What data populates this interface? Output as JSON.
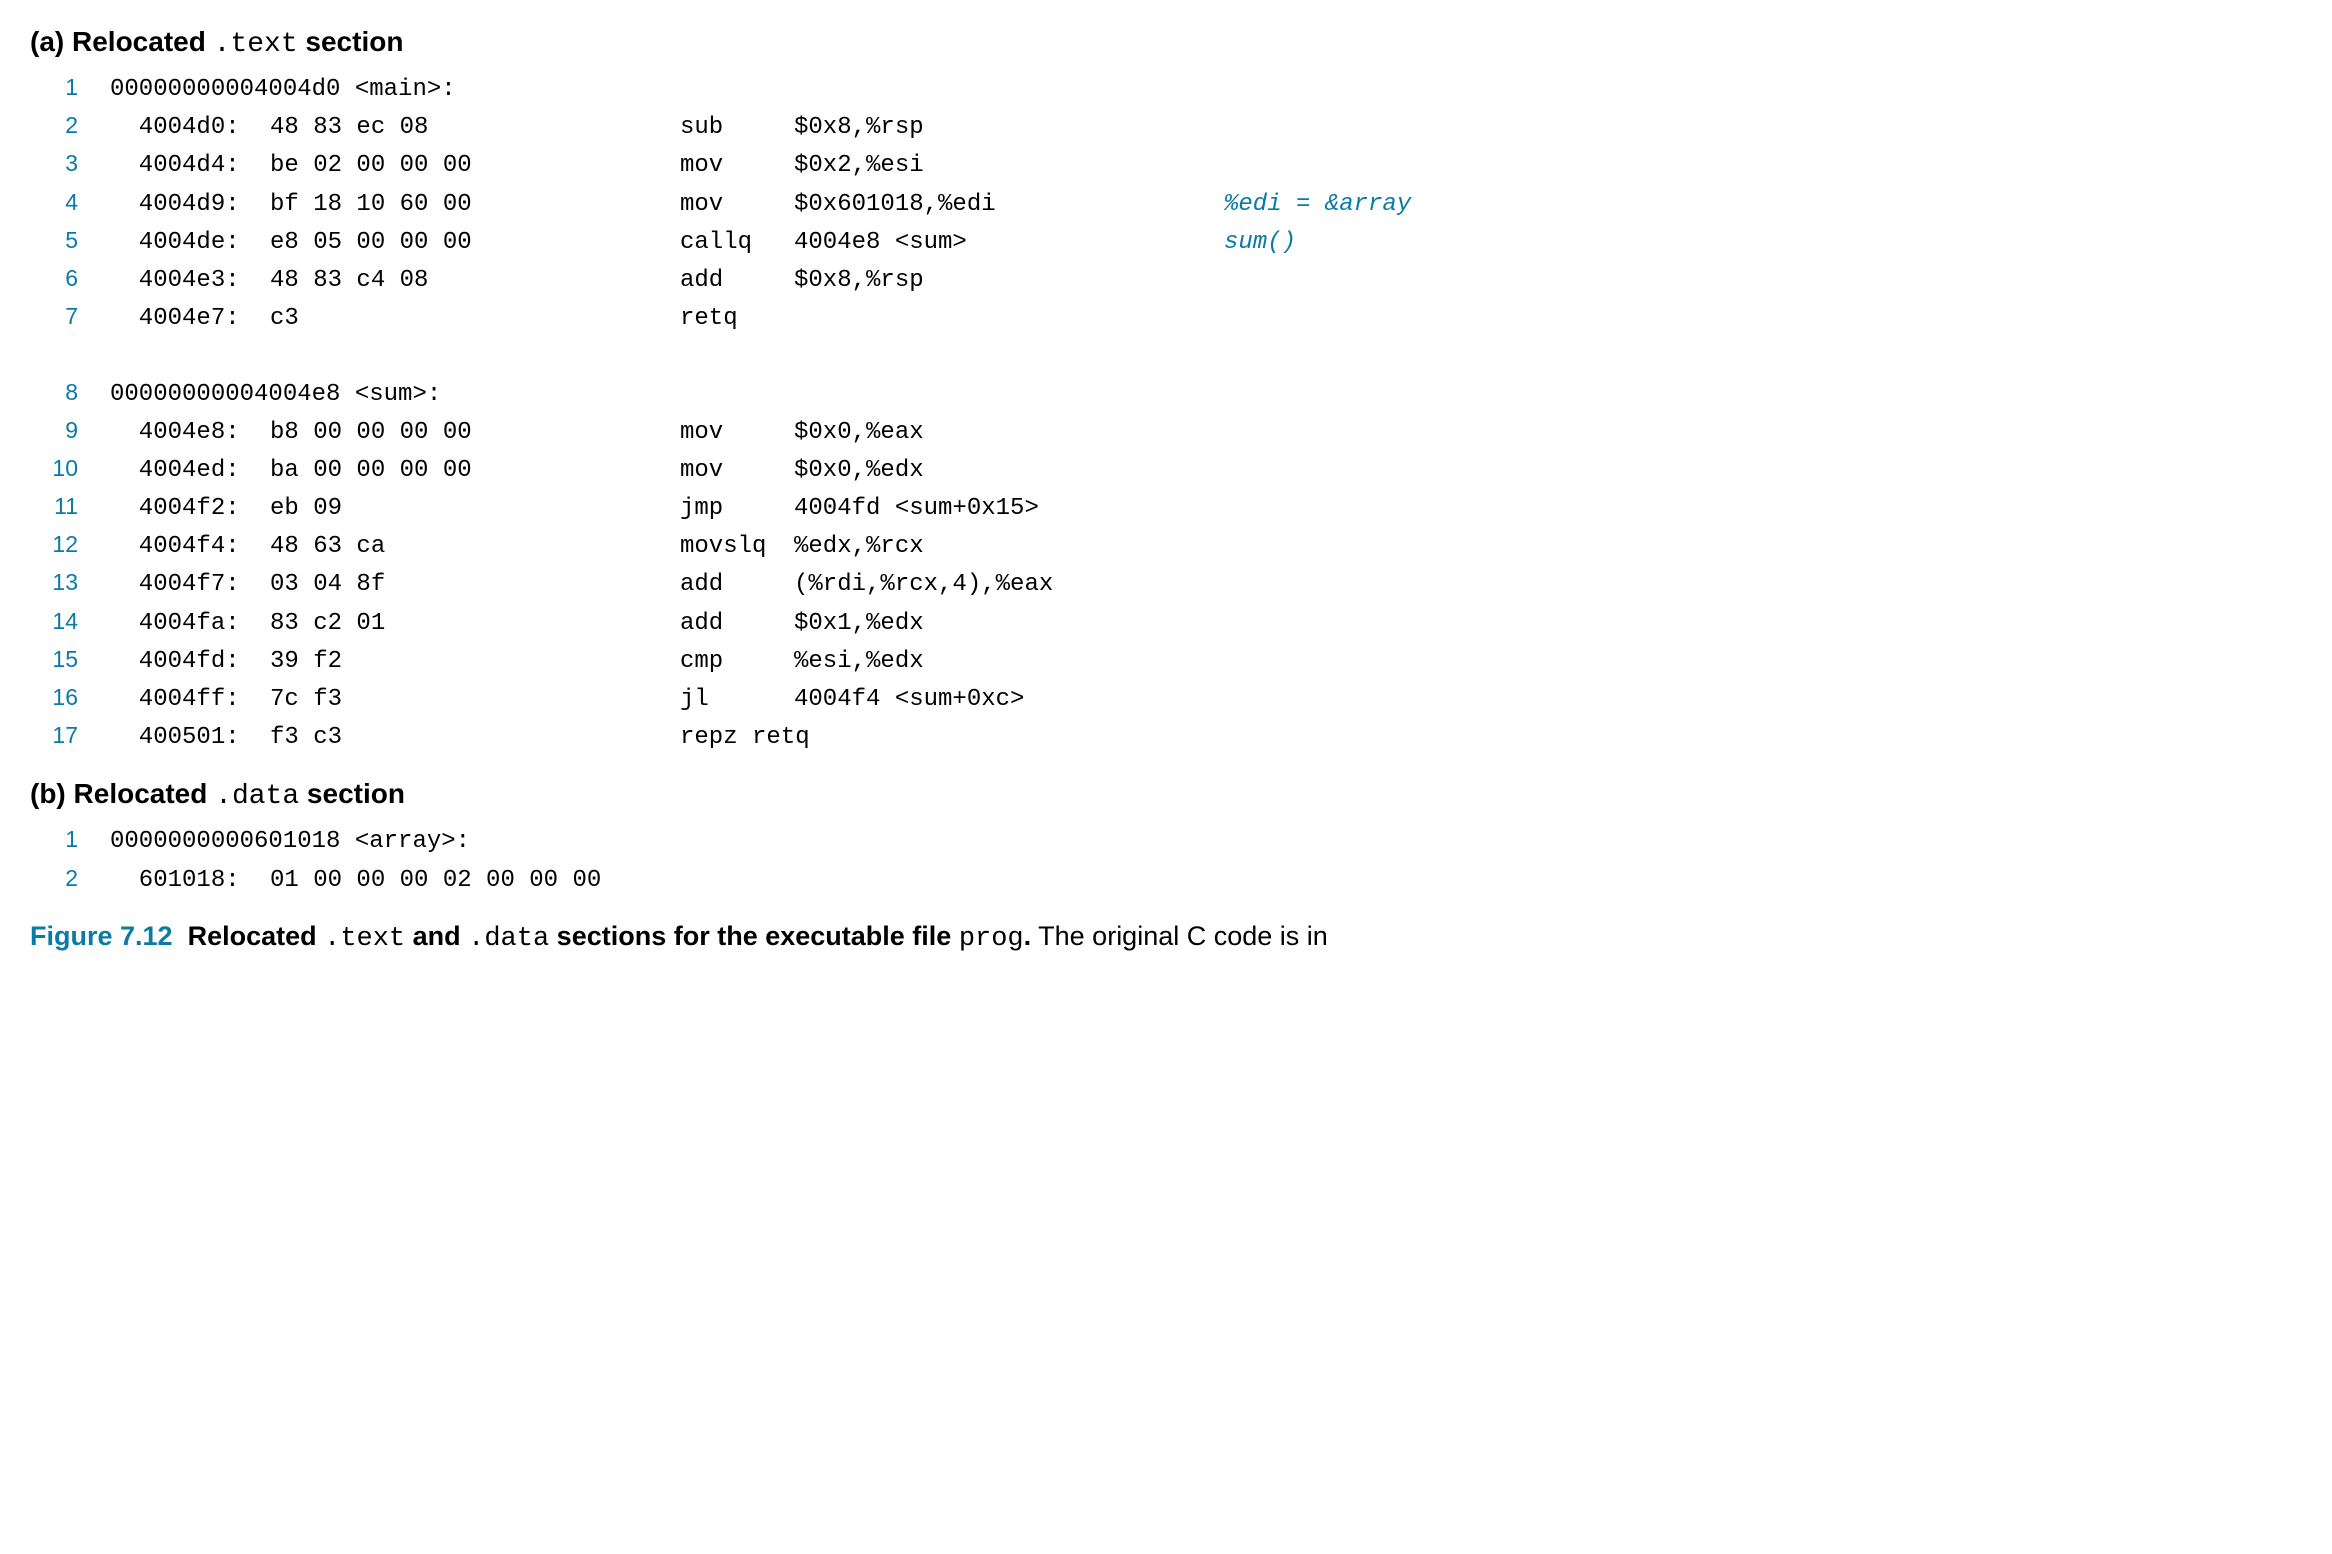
{
  "heading_a": {
    "pre": "(a) Relocated ",
    "mono": ".text",
    "post": " section"
  },
  "heading_b": {
    "pre": "(b) Relocated ",
    "mono": ".data",
    "post": " section"
  },
  "code_a": [
    {
      "ln": "1",
      "type": "sym",
      "text": "00000000004004d0 <main>:"
    },
    {
      "ln": "2",
      "type": "ins",
      "addr": "4004d0:",
      "bytes": "48 83 ec 08",
      "mn": "sub",
      "ops": "$0x8,%rsp",
      "cmt": ""
    },
    {
      "ln": "3",
      "type": "ins",
      "addr": "4004d4:",
      "bytes": "be 02 00 00 00",
      "mn": "mov",
      "ops": "$0x2,%esi",
      "cmt": ""
    },
    {
      "ln": "4",
      "type": "ins",
      "addr": "4004d9:",
      "bytes": "bf 18 10 60 00",
      "mn": "mov",
      "ops": "$0x601018,%edi",
      "cmt": "%edi = &array"
    },
    {
      "ln": "5",
      "type": "ins",
      "addr": "4004de:",
      "bytes": "e8 05 00 00 00",
      "mn": "callq",
      "ops": "4004e8 <sum>",
      "cmt": "sum()"
    },
    {
      "ln": "6",
      "type": "ins",
      "addr": "4004e3:",
      "bytes": "48 83 c4 08",
      "mn": "add",
      "ops": "$0x8,%rsp",
      "cmt": ""
    },
    {
      "ln": "7",
      "type": "ins",
      "addr": "4004e7:",
      "bytes": "c3",
      "mn": "retq",
      "ops": "",
      "cmt": ""
    },
    {
      "type": "blank"
    },
    {
      "ln": "8",
      "type": "sym",
      "text": "00000000004004e8 <sum>:"
    },
    {
      "ln": "9",
      "type": "ins",
      "addr": "4004e8:",
      "bytes": "b8 00 00 00 00",
      "mn": "mov",
      "ops": "$0x0,%eax",
      "cmt": ""
    },
    {
      "ln": "10",
      "type": "ins",
      "addr": "4004ed:",
      "bytes": "ba 00 00 00 00",
      "mn": "mov",
      "ops": "$0x0,%edx",
      "cmt": ""
    },
    {
      "ln": "11",
      "type": "ins",
      "addr": "4004f2:",
      "bytes": "eb 09",
      "mn": "jmp",
      "ops": "4004fd <sum+0x15>",
      "cmt": ""
    },
    {
      "ln": "12",
      "type": "ins",
      "addr": "4004f4:",
      "bytes": "48 63 ca",
      "mn": "movslq",
      "ops": "%edx,%rcx",
      "cmt": ""
    },
    {
      "ln": "13",
      "type": "ins",
      "addr": "4004f7:",
      "bytes": "03 04 8f",
      "mn": "add",
      "ops": "(%rdi,%rcx,4),%eax",
      "cmt": ""
    },
    {
      "ln": "14",
      "type": "ins",
      "addr": "4004fa:",
      "bytes": "83 c2 01",
      "mn": "add",
      "ops": "$0x1,%edx",
      "cmt": ""
    },
    {
      "ln": "15",
      "type": "ins",
      "addr": "4004fd:",
      "bytes": "39 f2",
      "mn": "cmp",
      "ops": "%esi,%edx",
      "cmt": ""
    },
    {
      "ln": "16",
      "type": "ins",
      "addr": "4004ff:",
      "bytes": "7c f3",
      "mn": "jl",
      "ops": "4004f4 <sum+0xc>",
      "cmt": ""
    },
    {
      "ln": "17",
      "type": "ins",
      "addr": "400501:",
      "bytes": "f3 c3",
      "mn": "repz r",
      "ops": "",
      "cmt": "",
      "full_mn": "repz retq"
    }
  ],
  "code_b": [
    {
      "ln": "1",
      "type": "sym",
      "text": "0000000000601018 <array>:"
    },
    {
      "ln": "2",
      "type": "ins",
      "addr": "601018:",
      "bytes": "01 00 00 00 02 00 00 00",
      "mn": "",
      "ops": "",
      "cmt": ""
    }
  ],
  "caption": {
    "figlabel": "Figure 7.12",
    "bold_pre": "Relocated ",
    "mono1": ".text",
    "bold_mid": " and ",
    "mono2": ".data",
    "bold_post": " sections for the executable file ",
    "mono3": "prog",
    "bold_dot": ".",
    "rest": " The original C code is in"
  }
}
